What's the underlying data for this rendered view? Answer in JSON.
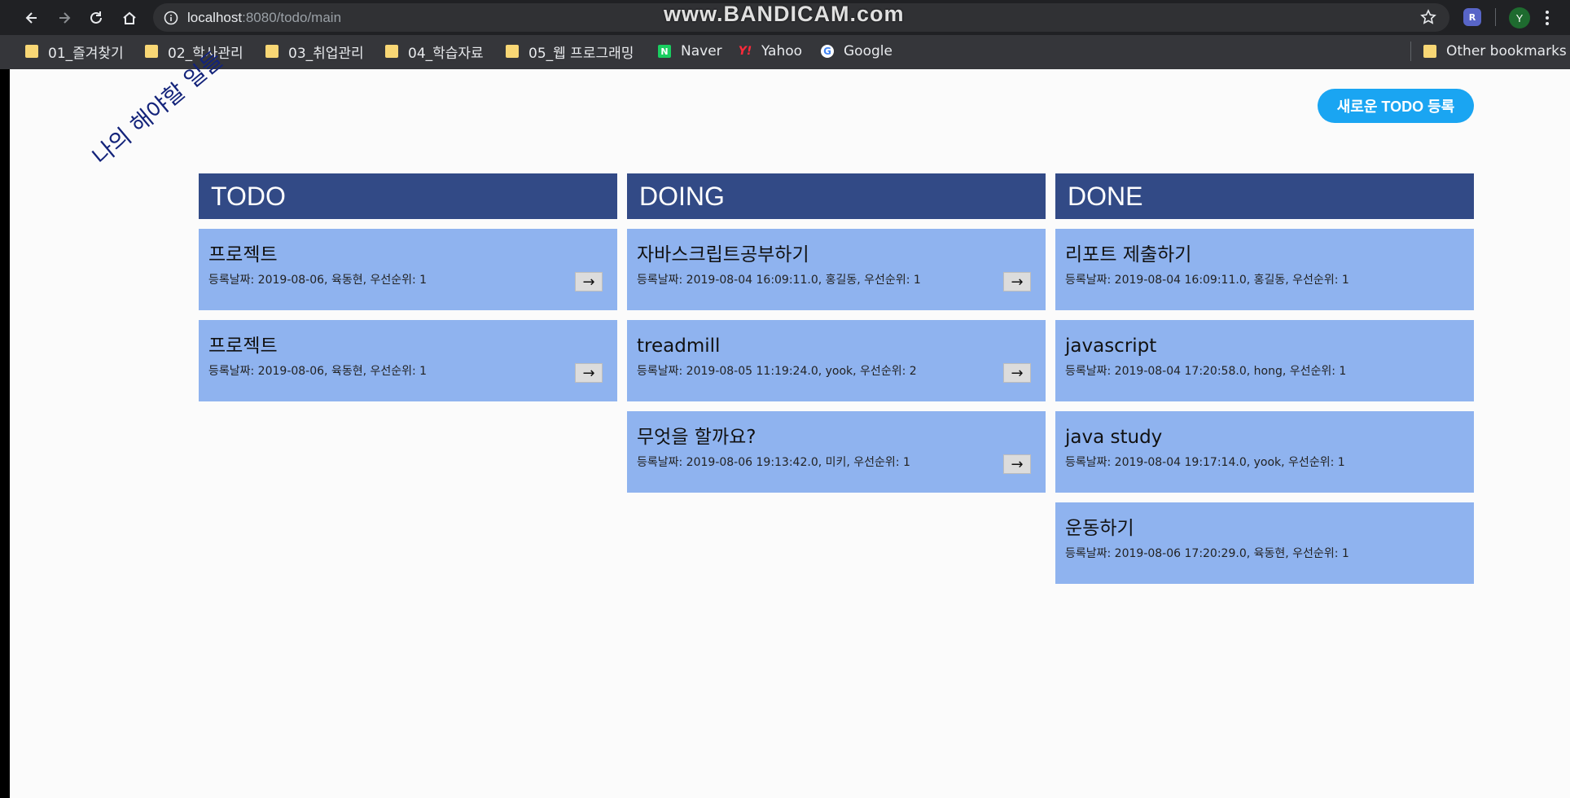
{
  "browser": {
    "url_host": "localhost",
    "url_path": ":8080/todo/main",
    "watermark": "www.BANDICAM.com",
    "profile_initial": "Y",
    "extension_initial": "R"
  },
  "bookmarks": {
    "items": [
      {
        "label": "01_즐겨찾기",
        "icon": "folder-icon"
      },
      {
        "label": "02_학사관리",
        "icon": "folder-icon"
      },
      {
        "label": "03_취업관리",
        "icon": "folder-icon"
      },
      {
        "label": "04_학습자료",
        "icon": "folder-icon"
      },
      {
        "label": "05_웹 프로그래밍",
        "icon": "folder-icon"
      },
      {
        "label": "Naver",
        "icon": "naver-icon"
      },
      {
        "label": "Yahoo",
        "icon": "yahoo-icon"
      },
      {
        "label": "Google",
        "icon": "google-icon"
      }
    ],
    "other": "Other bookmarks"
  },
  "page": {
    "heading": "나의 해야할 일들",
    "new_todo_button": "새로운 TODO 등록",
    "columns": [
      {
        "title": "TODO",
        "cards": [
          {
            "title": "프로젝트",
            "meta": "등록날짜: 2019-08-06,  육동현,  우선순위: 1",
            "move": "→"
          },
          {
            "title": "프로젝트",
            "meta": "등록날짜: 2019-08-06,  육동현,  우선순위: 1",
            "move": "→"
          }
        ]
      },
      {
        "title": "DOING",
        "cards": [
          {
            "title": "자바스크립트공부하기",
            "meta": "등록날짜: 2019-08-04 16:09:11.0,  홍길동,  우선순위: 1",
            "move": "→"
          },
          {
            "title": "treadmill",
            "meta": "등록날짜: 2019-08-05 11:19:24.0,  yook,  우선순위: 2",
            "move": "→"
          },
          {
            "title": "무엇을 할까요?",
            "meta": "등록날짜: 2019-08-06 19:13:42.0,  미키,  우선순위: 1",
            "move": "→"
          }
        ]
      },
      {
        "title": "DONE",
        "cards": [
          {
            "title": "리포트 제출하기",
            "meta": "등록날짜: 2019-08-04 16:09:11.0,  홍길동,  우선순위: 1"
          },
          {
            "title": "javascript",
            "meta": "등록날짜: 2019-08-04 17:20:58.0,  hong,  우선순위: 1"
          },
          {
            "title": "java study",
            "meta": "등록날짜: 2019-08-04 19:17:14.0,  yook,  우선순위: 1"
          },
          {
            "title": "운동하기",
            "meta": "등록날짜: 2019-08-06 17:20:29.0,  육동현,  우선순위: 1"
          }
        ]
      }
    ]
  },
  "colors": {
    "header_bg": "#324a86",
    "card_bg": "#8fb3ef",
    "button_bg": "#1aa5f2",
    "heading_color": "#13237a"
  }
}
